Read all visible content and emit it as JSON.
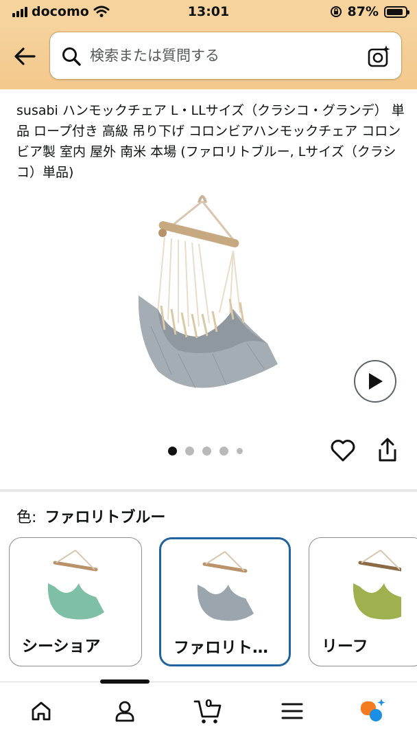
{
  "status_bar": {
    "carrier": "docomo",
    "time": "13:01",
    "battery": "87%",
    "battery_level": 0.87
  },
  "header": {
    "search_placeholder": "検索または質問する",
    "back_icon": "back-arrow-icon",
    "search_icon": "search-icon",
    "camera_icon": "camera-search-icon",
    "background_color": "#f6d29d"
  },
  "product": {
    "title": "susabi ハンモックチェア L・LLサイズ（クラシコ・グランデ） 単品 ロープ付き 高級 吊り下げ コロンビアハンモックチェア コロンビア製 室内 屋外 南米 本場 (ファロリトブルー, Lサイズ（クラシコ）単品)",
    "image_count": 5,
    "active_image_index": 0
  },
  "variation": {
    "label": "色:",
    "selected_value": "ファロリトブルー",
    "options": [
      {
        "label": "シーショア",
        "color": "#7fbfa6",
        "selected": false
      },
      {
        "label": "ファロリト…",
        "color": "#9aa5ad",
        "selected": true
      },
      {
        "label": "リーフ",
        "color": "#9fb04e",
        "selected": false
      }
    ],
    "selected_border_color": "#2162a1"
  },
  "bottom_nav": {
    "items": [
      "home-icon",
      "account-icon",
      "cart-icon",
      "menu-icon",
      "rufus-icon"
    ],
    "cart_count": "0",
    "active_index": 1
  }
}
